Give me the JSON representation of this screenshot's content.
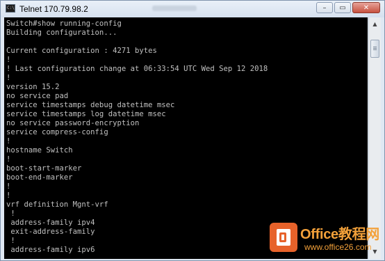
{
  "window": {
    "title": "Telnet 170.79.98.2",
    "app_icon_text": "C:\\",
    "controls": {
      "minimize": "–",
      "maximize": "▭",
      "close": "✕"
    }
  },
  "console": {
    "lines": [
      "Switch#show running-config",
      "Building configuration...",
      "",
      "Current configuration : 4271 bytes",
      "!",
      "! Last configuration change at 06:33:54 UTC Wed Sep 12 2018",
      "!",
      "version 15.2",
      "no service pad",
      "service timestamps debug datetime msec",
      "service timestamps log datetime msec",
      "no service password-encryption",
      "service compress-config",
      "!",
      "hostname Switch",
      "!",
      "boot-start-marker",
      "boot-end-marker",
      "!",
      "!",
      "vrf definition Mgnt-vrf",
      " !",
      " address-family ipv4",
      " exit-address-family",
      " !",
      " address-family ipv6"
    ]
  },
  "scrollbar": {
    "up_arrow": "▲",
    "down_arrow": "▼"
  },
  "watermark": {
    "brand": "Office教程网",
    "site": "www.office26.com"
  },
  "colors": {
    "console_bg": "#000000",
    "console_fg": "#c0c0c0",
    "watermark": "#e7622a"
  }
}
